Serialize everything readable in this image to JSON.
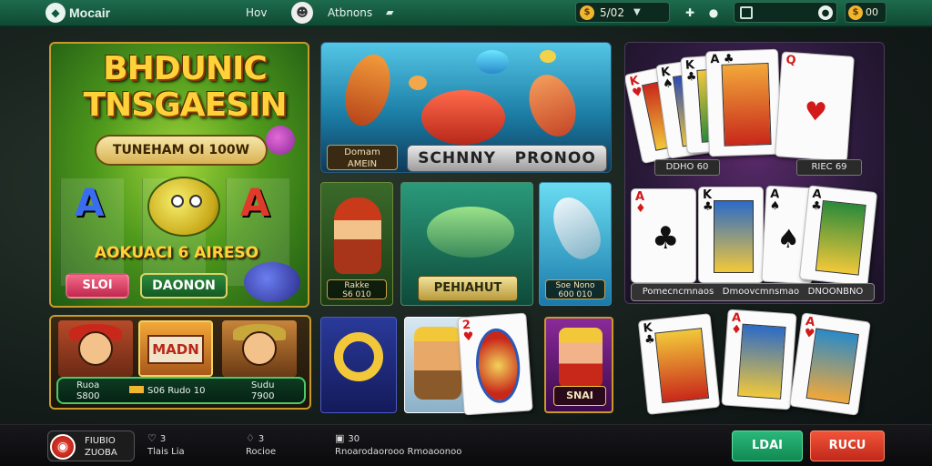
{
  "topbar": {
    "logo_text": "Mocair",
    "nav_home": "Hov",
    "nav_actions": "Atbnons",
    "coins_value": "5/02",
    "balance_value": "00"
  },
  "hero": {
    "title_line1": "BHDUNIC",
    "title_line2": "TNSGAESIN",
    "subtitle": "TUNEHAM OI 100W",
    "symbol_left": "A",
    "symbol_right": "A",
    "banner": "AOKUACI 6 AIRESO",
    "slot_button": "SLOI",
    "play_button": "DAONON"
  },
  "fishing": {
    "badge_line1": "Domam",
    "badge_line2": "AMEIN",
    "title": "SCHNNY   PRONOO"
  },
  "tiles": {
    "pirate_line1": "Rakke",
    "pirate_line2": "S6 010",
    "fish_green_label": "PEHIAHUT",
    "dolphin_line1": "Soe Nono",
    "dolphin_line2": "600 010"
  },
  "lower_left": {
    "mad_label": "MADN",
    "info_c1_line1": "Ruoa",
    "info_c1_line2": "S800",
    "info_c2": "S06 Rudo 10",
    "info_c3_line1": "Sudu",
    "info_c3_line2": "7900"
  },
  "queen_label": "SNAI",
  "cards_panel": {
    "label_left": "DDHO 60",
    "label_right": "RIEC 69",
    "wide_label": "Pomecncmnaos   Dmoovcmnsmao   DNOONBNO",
    "top_cards": [
      {
        "rank": "K",
        "suit": "♥"
      },
      {
        "rank": "K",
        "suit": "♠"
      },
      {
        "rank": "K",
        "suit": "♣"
      },
      {
        "rank": "A",
        "suit": "♣"
      },
      {
        "rank": "Q",
        "suit": "♥"
      }
    ],
    "mid_cards": [
      {
        "rank": "A",
        "suit": "♦"
      },
      {
        "rank": "K",
        "suit": "♣"
      },
      {
        "rank": "A",
        "suit": "♠"
      },
      {
        "rank": "A",
        "suit": "♣"
      }
    ],
    "bottom_cards": [
      {
        "rank": "K",
        "suit": "♣"
      },
      {
        "rank": "A",
        "suit": "♦"
      },
      {
        "rank": "A",
        "suit": "♥"
      }
    ]
  },
  "mid_card": {
    "rank": "2",
    "suit": "♥"
  },
  "bottombar": {
    "user_line1": "FIUBIO",
    "user_line2": "ZUOBA",
    "stat1_value": "3",
    "stat1_label": "Tlais Lia",
    "stat2_value": "3",
    "stat2_label": "Rocioe",
    "stat3_value": "30",
    "stat3_label": "Rnoarodaorooo Rmoaoonoo",
    "btn_green": "LDAI",
    "btn_red": "RUCU"
  },
  "colors": {
    "topbar": "#1d6b4c",
    "hero_border": "#c99a2a",
    "green_button": "#2ab87a",
    "red_button": "#f2543a"
  }
}
